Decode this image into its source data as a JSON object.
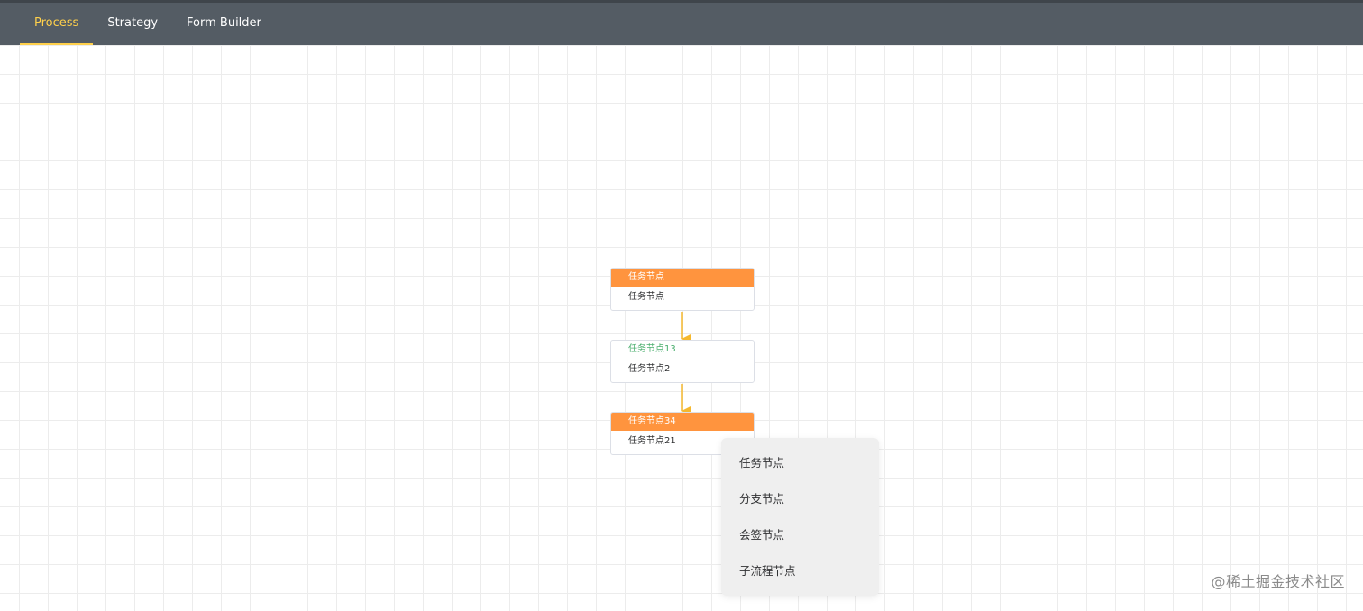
{
  "nav": {
    "tabs": [
      {
        "label": "Process",
        "active": true
      },
      {
        "label": "Strategy",
        "active": false
      },
      {
        "label": "Form Builder",
        "active": false
      }
    ]
  },
  "flow": {
    "nodes": [
      {
        "title": "任务节点",
        "content": "任务节点",
        "style": "highlight"
      },
      {
        "title": "任务节点13",
        "content": "任务节点2",
        "style": "plain"
      },
      {
        "title": "任务节点34",
        "content": "任务节点21",
        "style": "highlight"
      }
    ]
  },
  "context_menu": {
    "items": [
      "任务节点",
      "分支节点",
      "会签节点",
      "子流程节点"
    ]
  },
  "watermark": "@稀土掘金技术社区",
  "colors": {
    "navbar_bg": "#545c64",
    "nav_active": "#ffd04b",
    "node_header": "#ff943e",
    "edge": "#f5b82e",
    "plain_title": "#4caf6f"
  }
}
